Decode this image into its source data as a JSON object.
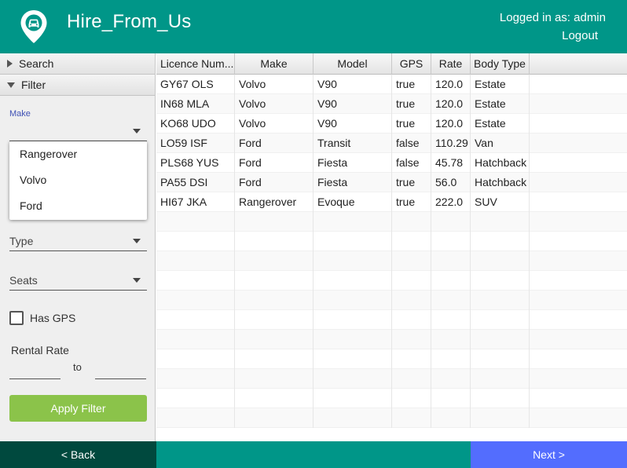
{
  "header": {
    "title": "Hire_From_Us",
    "logged_in": "Logged in as: admin",
    "logout": "Logout",
    "logo_icon": "car-location-pin-icon",
    "color": "#009688"
  },
  "sidebar": {
    "search_title": "Search",
    "filter_title": "Filter",
    "make_label": "Make",
    "make_options": [
      "Rangerover",
      "Volvo",
      "Ford"
    ],
    "type_label": "Type",
    "seats_label": "Seats",
    "gps_label": "Has GPS",
    "gps_checked": false,
    "rental_rate_label": "Rental Rate",
    "rate_to": "to",
    "rate_min": "",
    "rate_max": "",
    "apply_label": "Apply Filter",
    "apply_color": "#8bc34a"
  },
  "table": {
    "columns": [
      "Licence Num...",
      "Make",
      "Model",
      "GPS",
      "Rate",
      "Body Type"
    ],
    "rows": [
      [
        "GY67 OLS",
        "Volvo",
        "V90",
        "true",
        "120.0",
        "Estate"
      ],
      [
        "IN68 MLA",
        "Volvo",
        "V90",
        "true",
        "120.0",
        "Estate"
      ],
      [
        "KO68 UDO",
        "Volvo",
        "V90",
        "true",
        "120.0",
        "Estate"
      ],
      [
        "LO59 ISF",
        "Ford",
        "Transit",
        "false",
        "110.29",
        "Van"
      ],
      [
        "PLS68 YUS",
        "Ford",
        "Fiesta",
        "false",
        "45.78",
        "Hatchback"
      ],
      [
        "PA55 DSI",
        "Ford",
        "Fiesta",
        "true",
        "56.0",
        "Hatchback"
      ],
      [
        "HI67 JKA",
        "Rangerover",
        "Evoque",
        "true",
        "222.0",
        "SUV"
      ]
    ]
  },
  "footer": {
    "back": "< Back",
    "next": "Next >",
    "back_color": "#00493e",
    "next_color": "#536dfe"
  }
}
